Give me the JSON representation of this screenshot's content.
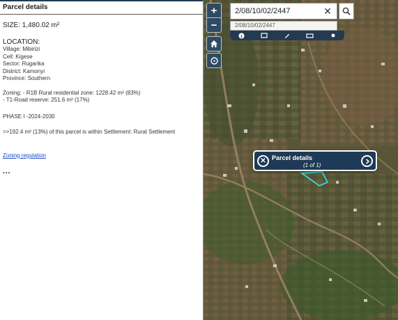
{
  "panel": {
    "title": "Parcel details",
    "size": "SIZE: 1,480.02 m²",
    "location_heading": "LOCATION:",
    "location_lines": [
      "Village: Mibirizi",
      "Cell: Kigese",
      "Sector: Rugarika",
      "District: Kamonyi",
      "Province: Southern"
    ],
    "zoning_lines": [
      "Zoning:  - R1B Rural residential zone: 1228.42 m² (83%)",
      "- T1-Road reserve: 251.6 m² (17%)"
    ],
    "phase": "PHASE I -2024-2030",
    "settlement": ">>192.4 m² (13%) of this parcel is within Settlement: Rural Settlement",
    "zoning_link": "Zoning regulation",
    "more": "•••"
  },
  "map": {
    "zoom_in": "+",
    "zoom_out": "−",
    "search": {
      "value": "2/08/10/02/2447",
      "suggestion": "2/08/10/02/2447"
    },
    "toolbar_icons": [
      "info-icon",
      "layers-icon",
      "edit-icon",
      "print-icon",
      "more-icon"
    ],
    "popup": {
      "title": "Parcel details",
      "count": "(1 of 1)"
    }
  },
  "colors": {
    "header_dark": "#1f3a56",
    "link": "#1a49c4",
    "parcel_outline": "#39d6d6"
  }
}
